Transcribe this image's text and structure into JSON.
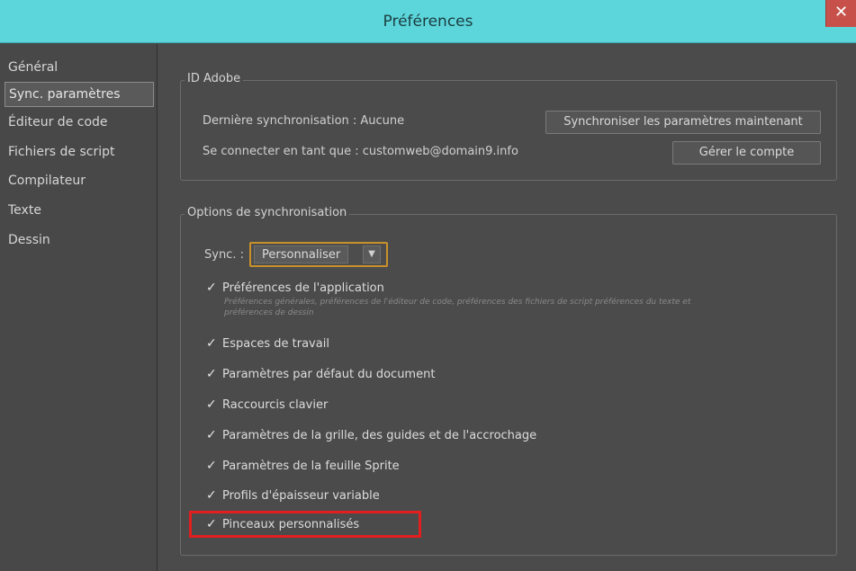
{
  "window": {
    "title": "Préférences",
    "close_glyph": "✕"
  },
  "sidebar": {
    "items": [
      {
        "label": "Général"
      },
      {
        "label": "Sync. paramètres",
        "selected": true
      },
      {
        "label": "Éditeur de code"
      },
      {
        "label": "Fichiers de script"
      },
      {
        "label": "Compilateur"
      },
      {
        "label": "Texte"
      },
      {
        "label": "Dessin"
      }
    ]
  },
  "adobe_id": {
    "group_label": "ID Adobe",
    "last_sync_text": "Dernière synchronisation : Aucune",
    "connected_as_text": "Se connecter en tant que : customweb@domain9.info",
    "sync_now_button": "Synchroniser les paramètres maintenant",
    "manage_account_button": "Gérer le compte"
  },
  "sync_options": {
    "group_label": "Options de synchronisation",
    "sync_label": "Sync. :",
    "sync_value": "Personnaliser",
    "dropdown_arrow": "▼",
    "check_glyph": "✓",
    "app_prefs_description": "Préférences générales, préférences de l'éditeur de code, préférences des fichiers de script préférences du texte et préférences de dessin",
    "options": [
      {
        "label": "Préférences de l'application",
        "checked": true
      },
      {
        "label": "Espaces de travail",
        "checked": true
      },
      {
        "label": "Paramètres par défaut du document",
        "checked": true
      },
      {
        "label": "Raccourcis clavier",
        "checked": true
      },
      {
        "label": "Paramètres de la grille, des guides et de l'accrochage",
        "checked": true
      },
      {
        "label": "Paramètres de la feuille Sprite",
        "checked": true
      },
      {
        "label": "Profils d'épaisseur variable",
        "checked": true
      },
      {
        "label": "Pinceaux personnalisés",
        "checked": true,
        "highlighted": true
      }
    ]
  },
  "colors": {
    "titlebar": "#5cd6db",
    "highlight_border": "#e21e1e",
    "dropdown_focus": "#c9912a"
  }
}
